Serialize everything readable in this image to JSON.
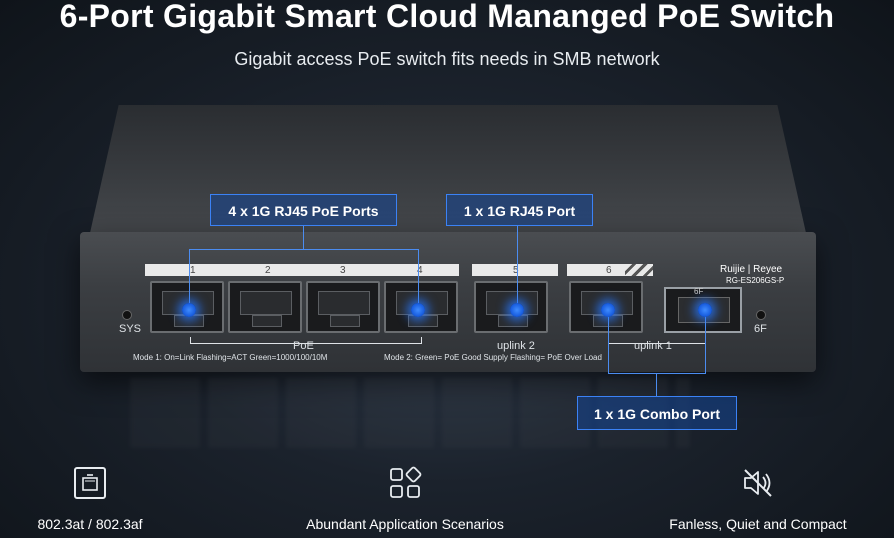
{
  "header": {
    "title": "6-Port Gigabit Smart Cloud Mananged PoE Switch",
    "subtitle": "Gigabit access PoE switch fits needs in SMB network"
  },
  "callouts": {
    "poe_ports": "4 x 1G RJ45 PoE Ports",
    "rj45_port": "1 x 1G RJ45 Port",
    "combo_port": "1 x 1G Combo Port"
  },
  "device": {
    "brand": "Ruijie | Reyee",
    "model": "RG-ES206GS-P",
    "sys_label": "SYS",
    "port_numbers": [
      "1",
      "2",
      "3",
      "4",
      "5",
      "6"
    ],
    "sfp_number": "6F",
    "sfp_led_label": "6F",
    "poe_group_label": "PoE",
    "uplink2_label": "uplink 2",
    "uplink1_label": "uplink 1",
    "mode1": "Mode 1:  On=Link  Flashing=ACT   Green=1000/100/10M",
    "mode2": "Mode 2:  Green= PoE Good Supply   Flashing= PoE Over Load"
  },
  "features": [
    {
      "icon": "ethernet-port-icon",
      "label": "802.3at / 802.3af"
    },
    {
      "icon": "app-grid-icon",
      "label": "Abundant Application Scenarios"
    },
    {
      "icon": "fan-off-icon",
      "label": "Fanless, Quiet and Compact"
    }
  ],
  "colors": {
    "accent": "#3b82f6",
    "glow": "#2878ff",
    "background": "#1b222c"
  }
}
